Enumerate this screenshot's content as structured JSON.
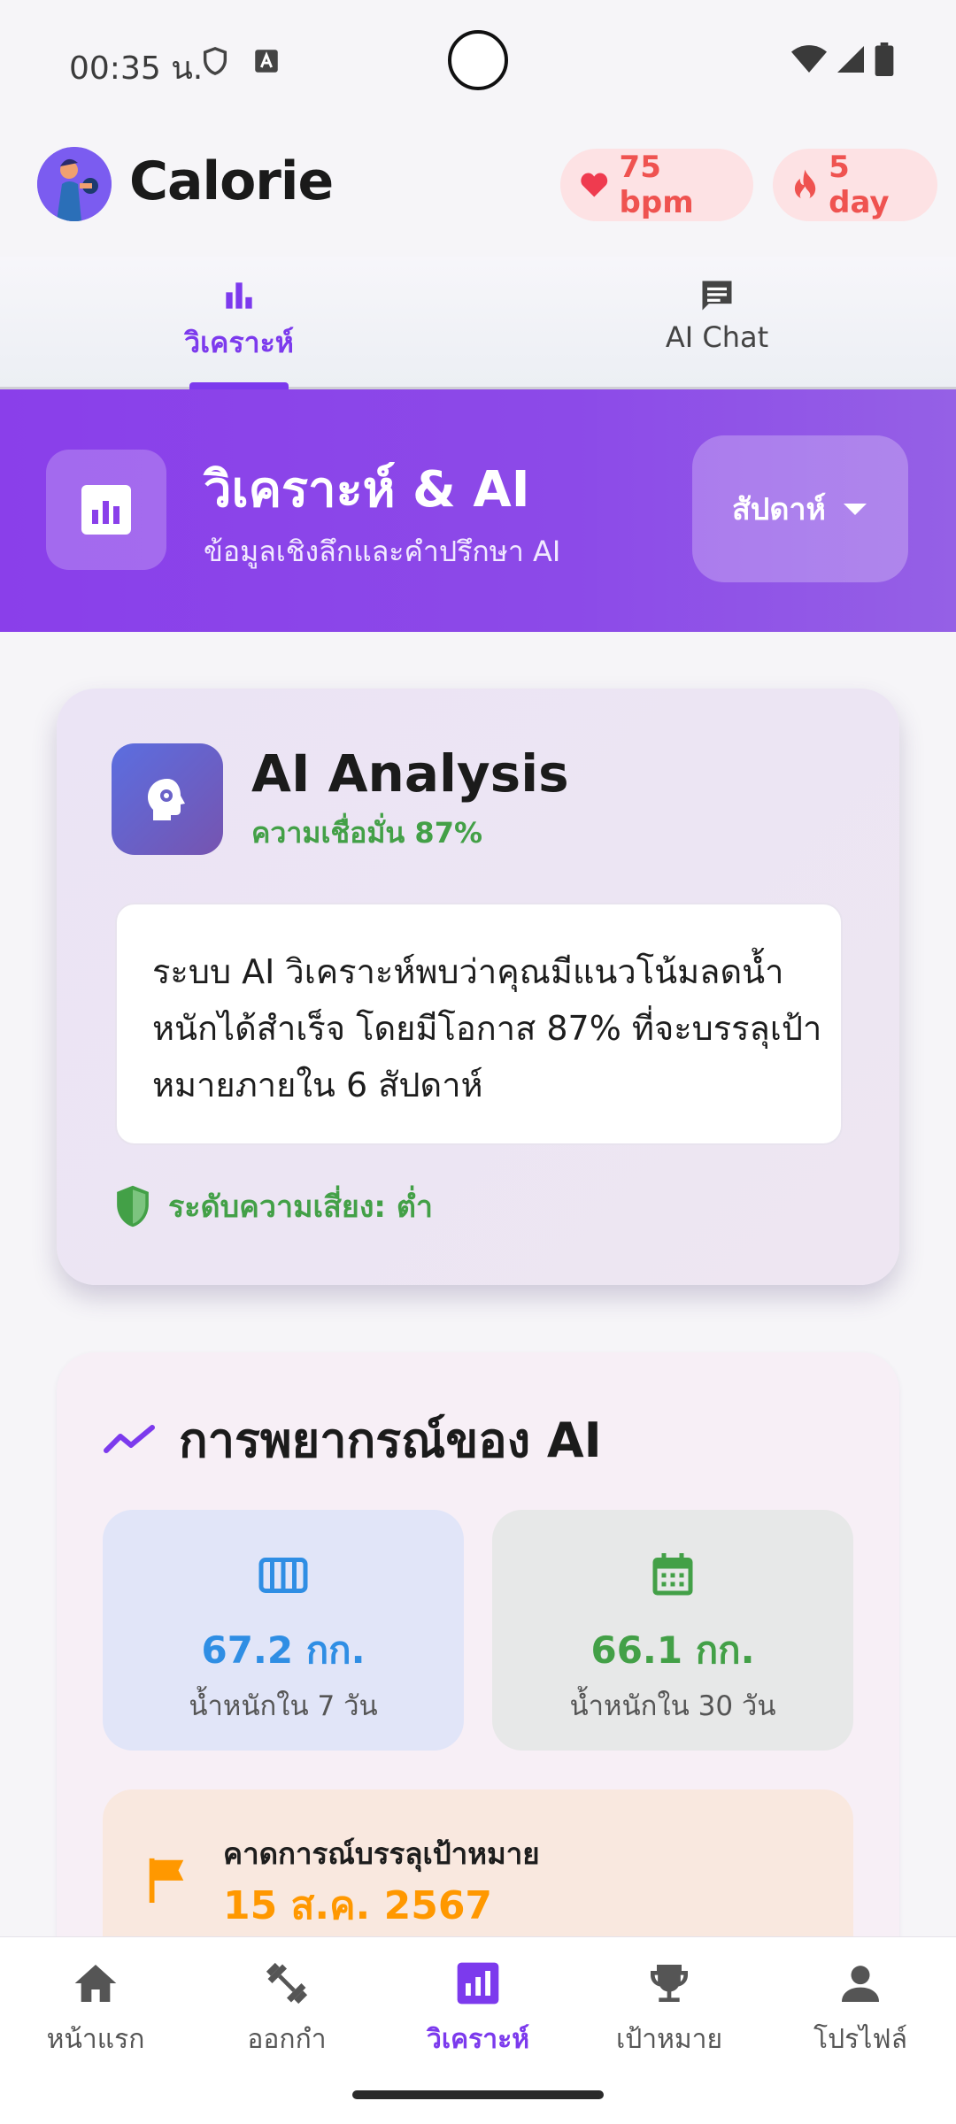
{
  "status_bar": {
    "time": "00:35 น.",
    "left_icons": [
      "shield-icon",
      "a-badge-icon"
    ],
    "right_icons": [
      "wifi-icon",
      "signal-icon",
      "battery-icon"
    ]
  },
  "header": {
    "title": "Calorie",
    "heart_rate": "75 bpm",
    "streak": "5 day"
  },
  "top_tabs": [
    {
      "label": "วิเคราะห์",
      "icon": "bar-chart-icon",
      "active": true
    },
    {
      "label": "AI Chat",
      "icon": "chat-icon",
      "active": false
    }
  ],
  "banner": {
    "title": "วิเคราะห์ & AI",
    "subtitle": "ข้อมูลเชิงลึกและคำปรึกษา AI",
    "period": "สัปดาห์"
  },
  "analysis": {
    "title": "AI Analysis",
    "confidence": "ความเชื่อมั่น 87%",
    "body": "ระบบ AI วิเคราะห์พบว่าคุณมีแนวโน้มลดน้ำหนักได้สำเร็จ โดยมีโอกาส 87% ที่จะบรรลุเป้าหมายภายใน 6 สัปดาห์",
    "risk": "ระดับความเสี่ยง: ต่ำ"
  },
  "prediction": {
    "title": "การพยากรณ์ของ AI",
    "week": {
      "value": "67.2 กก.",
      "label": "น้ำหนักใน 7 วัน"
    },
    "month": {
      "value": "66.1 กก.",
      "label": "น้ำหนักใน 30 วัน"
    },
    "goal": {
      "label": "คาดการณ์บรรลุเป้าหมาย",
      "date": "15 ส.ค. 2567"
    }
  },
  "bottom_nav": [
    {
      "label": "หน้าแรก",
      "icon": "home-icon"
    },
    {
      "label": "ออกกำ",
      "icon": "dumbbell-icon"
    },
    {
      "label": "วิเคราะห์",
      "icon": "analytics-icon",
      "active": true
    },
    {
      "label": "เป้าหมาย",
      "icon": "trophy-icon"
    },
    {
      "label": "โปรไฟล์",
      "icon": "person-icon"
    }
  ],
  "colors": {
    "primary": "#7c3aed",
    "banner_start": "#8a3fea",
    "success": "#43a047",
    "info": "#2f8ee4",
    "warning": "#ff9800",
    "danger": "#ef5350"
  }
}
